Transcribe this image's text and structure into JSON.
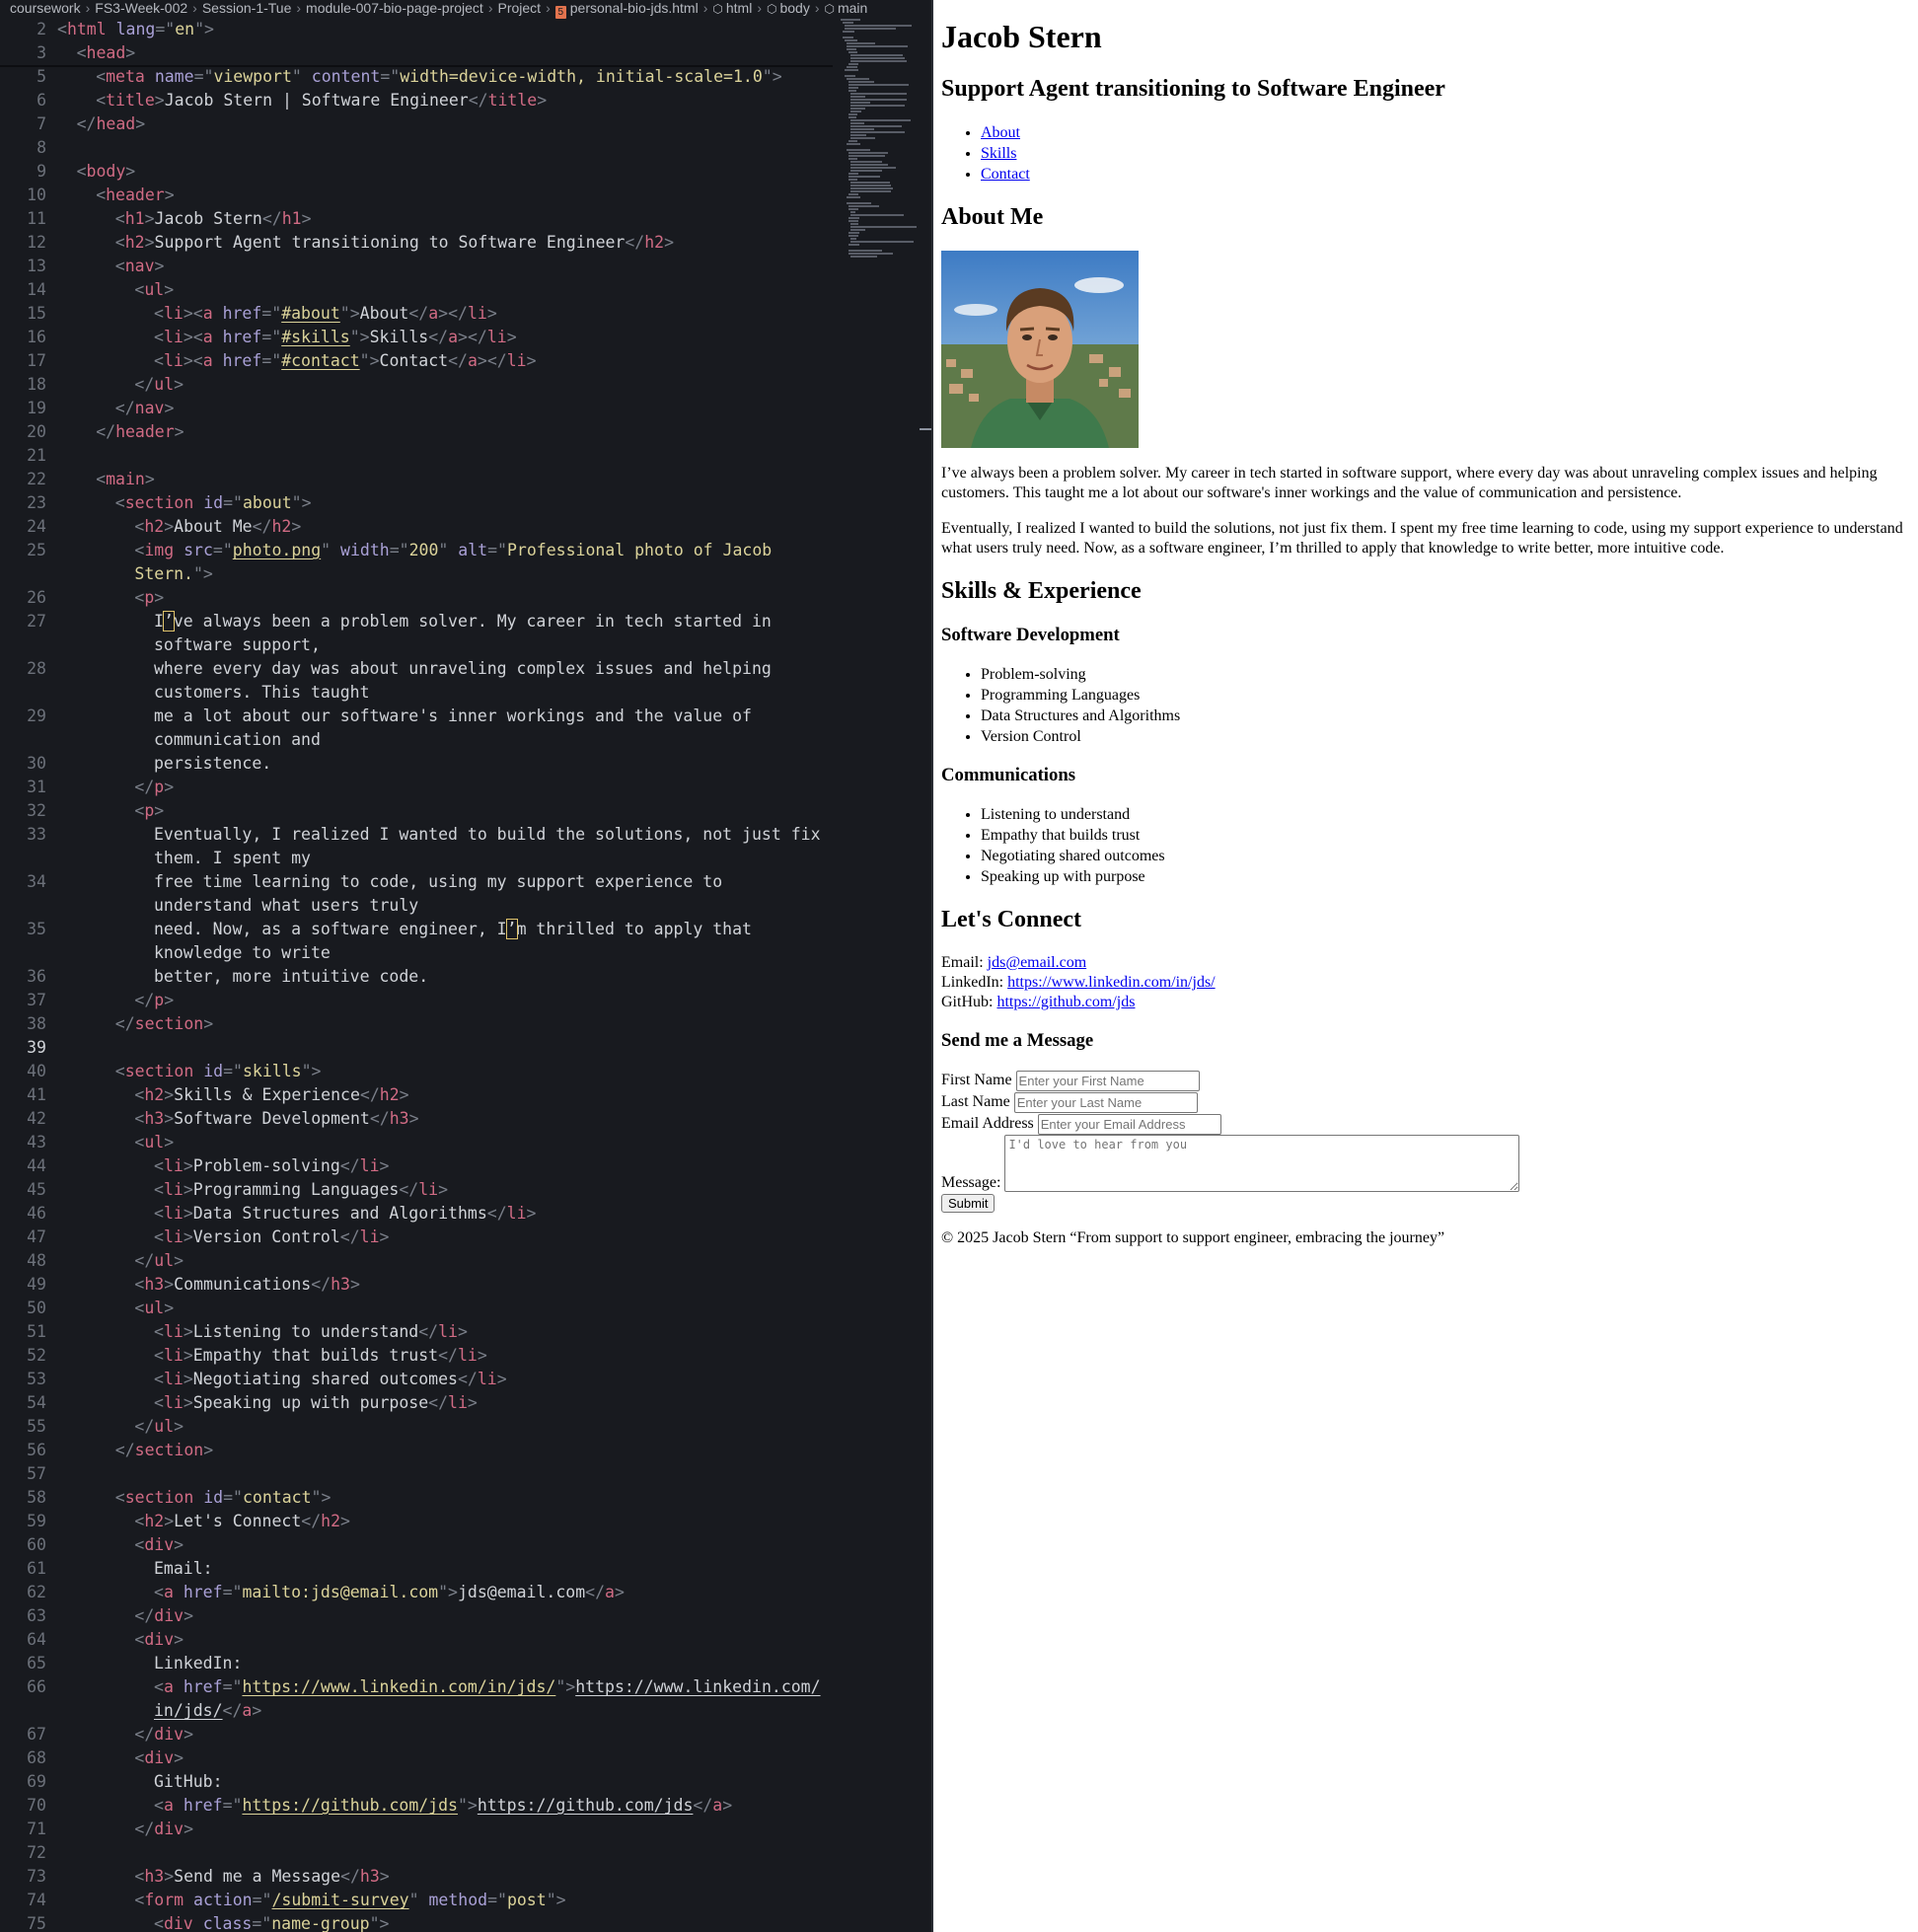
{
  "breadcrumb": [
    "coursework",
    "FS3-Week-002",
    "Session-1-Tue",
    "module-007-bio-page-project",
    "Project",
    "personal-bio-jds.html",
    "html",
    "body",
    "main"
  ],
  "editor": {
    "lines": [
      {
        "n": "2",
        "i": 0,
        "h": "<span class=\"pu\">&lt;</span><span class=\"tg\">html</span> <span class=\"at\">lang</span><span class=\"pu\">=\"</span><span class=\"st\">en</span><span class=\"pu\">\"&gt;</span>"
      },
      {
        "n": "3",
        "i": 1,
        "h": "<span class=\"pu\">&lt;</span><span class=\"tg\">head</span><span class=\"pu\">&gt;</span>"
      },
      {
        "n": "5",
        "i": 2,
        "h": "<span class=\"pu\">&lt;</span><span class=\"tg\">meta</span> <span class=\"at\">name</span><span class=\"pu\">=\"</span><span class=\"st\">viewport</span><span class=\"pu\">\"</span> <span class=\"at\">content</span><span class=\"pu\">=\"</span><span class=\"st\">width=device-width, initial-scale=1.0</span><span class=\"pu\">\"&gt;</span>"
      },
      {
        "n": "6",
        "i": 2,
        "h": "<span class=\"pu\">&lt;</span><span class=\"tg\">title</span><span class=\"pu\">&gt;</span>Jacob Stern | Software Engineer<span class=\"pu\">&lt;/</span><span class=\"tg\">title</span><span class=\"pu\">&gt;</span>"
      },
      {
        "n": "7",
        "i": 1,
        "h": "<span class=\"pu\">&lt;/</span><span class=\"tg\">head</span><span class=\"pu\">&gt;</span>"
      },
      {
        "n": "8",
        "i": 0,
        "h": ""
      },
      {
        "n": "9",
        "i": 1,
        "h": "<span class=\"pu\">&lt;</span><span class=\"tg\">body</span><span class=\"pu\">&gt;</span>"
      },
      {
        "n": "10",
        "i": 2,
        "h": "<span class=\"pu\">&lt;</span><span class=\"tg\">header</span><span class=\"pu\">&gt;</span>"
      },
      {
        "n": "11",
        "i": 3,
        "h": "<span class=\"pu\">&lt;</span><span class=\"tg\">h1</span><span class=\"pu\">&gt;</span>Jacob Stern<span class=\"pu\">&lt;/</span><span class=\"tg\">h1</span><span class=\"pu\">&gt;</span>"
      },
      {
        "n": "12",
        "i": 3,
        "h": "<span class=\"pu\">&lt;</span><span class=\"tg\">h2</span><span class=\"pu\">&gt;</span>Support Agent transitioning to Software Engineer<span class=\"pu\">&lt;/</span><span class=\"tg\">h2</span><span class=\"pu\">&gt;</span>"
      },
      {
        "n": "13",
        "i": 3,
        "h": "<span class=\"pu\">&lt;</span><span class=\"tg\">nav</span><span class=\"pu\">&gt;</span>"
      },
      {
        "n": "14",
        "i": 4,
        "h": "<span class=\"pu\">&lt;</span><span class=\"tg\">ul</span><span class=\"pu\">&gt;</span>"
      },
      {
        "n": "15",
        "i": 5,
        "h": "<span class=\"pu\">&lt;</span><span class=\"tg\">li</span><span class=\"pu\">&gt;&lt;</span><span class=\"tg\">a</span> <span class=\"at\">href</span><span class=\"pu\">=\"</span><span class=\"st ul\">#about</span><span class=\"pu\">\"&gt;</span>About<span class=\"pu\">&lt;/</span><span class=\"tg\">a</span><span class=\"pu\">&gt;&lt;/</span><span class=\"tg\">li</span><span class=\"pu\">&gt;</span>"
      },
      {
        "n": "16",
        "i": 5,
        "h": "<span class=\"pu\">&lt;</span><span class=\"tg\">li</span><span class=\"pu\">&gt;&lt;</span><span class=\"tg\">a</span> <span class=\"at\">href</span><span class=\"pu\">=\"</span><span class=\"st ul\">#skills</span><span class=\"pu\">\"&gt;</span>Skills<span class=\"pu\">&lt;/</span><span class=\"tg\">a</span><span class=\"pu\">&gt;&lt;/</span><span class=\"tg\">li</span><span class=\"pu\">&gt;</span>"
      },
      {
        "n": "17",
        "i": 5,
        "h": "<span class=\"pu\">&lt;</span><span class=\"tg\">li</span><span class=\"pu\">&gt;&lt;</span><span class=\"tg\">a</span> <span class=\"at\">href</span><span class=\"pu\">=\"</span><span class=\"st ul\">#contact</span><span class=\"pu\">\"&gt;</span>Contact<span class=\"pu\">&lt;/</span><span class=\"tg\">a</span><span class=\"pu\">&gt;&lt;/</span><span class=\"tg\">li</span><span class=\"pu\">&gt;</span>"
      },
      {
        "n": "18",
        "i": 4,
        "h": "<span class=\"pu\">&lt;/</span><span class=\"tg\">ul</span><span class=\"pu\">&gt;</span>"
      },
      {
        "n": "19",
        "i": 3,
        "h": "<span class=\"pu\">&lt;/</span><span class=\"tg\">nav</span><span class=\"pu\">&gt;</span>"
      },
      {
        "n": "20",
        "i": 2,
        "h": "<span class=\"pu\">&lt;/</span><span class=\"tg\">header</span><span class=\"pu\">&gt;</span>"
      },
      {
        "n": "21",
        "i": 0,
        "h": ""
      },
      {
        "n": "22",
        "i": 2,
        "h": "<span class=\"pu\">&lt;</span><span class=\"tg\">main</span><span class=\"pu\">&gt;</span>"
      },
      {
        "n": "23",
        "i": 3,
        "h": "<span class=\"pu\">&lt;</span><span class=\"tg\">section</span> <span class=\"at\">id</span><span class=\"pu\">=\"</span><span class=\"st\">about</span><span class=\"pu\">\"&gt;</span>"
      },
      {
        "n": "24",
        "i": 4,
        "h": "<span class=\"pu\">&lt;</span><span class=\"tg\">h2</span><span class=\"pu\">&gt;</span>About Me<span class=\"pu\">&lt;/</span><span class=\"tg\">h2</span><span class=\"pu\">&gt;</span>"
      },
      {
        "n": "25",
        "i": 4,
        "h": "<span class=\"pu\">&lt;</span><span class=\"tg\">img</span> <span class=\"at\">src</span><span class=\"pu\">=\"</span><span class=\"st ul\">photo.png</span><span class=\"pu\">\"</span> <span class=\"at\">width</span><span class=\"pu\">=\"</span><span class=\"st\">200</span><span class=\"pu\">\"</span> <span class=\"at\">alt</span><span class=\"pu\">=\"</span><span class=\"st\">Professional photo of Jacob</span>"
      },
      {
        "n": "",
        "i": 4,
        "h": "<span class=\"st\">Stern.</span><span class=\"pu\">\"&gt;</span>"
      },
      {
        "n": "26",
        "i": 4,
        "h": "<span class=\"pu\">&lt;</span><span class=\"tg\">p</span><span class=\"pu\">&gt;</span>"
      },
      {
        "n": "27",
        "i": 5,
        "h": "I<span class=\"hl\">’</span>ve always been a problem solver. My career in tech started in"
      },
      {
        "n": "",
        "i": 5,
        "h": "software support,"
      },
      {
        "n": "28",
        "i": 5,
        "h": "where every day was about unraveling complex issues and helping"
      },
      {
        "n": "",
        "i": 5,
        "h": "customers. This taught"
      },
      {
        "n": "29",
        "i": 5,
        "h": "me a lot about our software's inner workings and the value of"
      },
      {
        "n": "",
        "i": 5,
        "h": "communication and"
      },
      {
        "n": "30",
        "i": 5,
        "h": "persistence."
      },
      {
        "n": "31",
        "i": 4,
        "h": "<span class=\"pu\">&lt;/</span><span class=\"tg\">p</span><span class=\"pu\">&gt;</span>"
      },
      {
        "n": "32",
        "i": 4,
        "h": "<span class=\"pu\">&lt;</span><span class=\"tg\">p</span><span class=\"pu\">&gt;</span>"
      },
      {
        "n": "33",
        "i": 5,
        "h": "Eventually, I realized I wanted to build the solutions, not just fix"
      },
      {
        "n": "",
        "i": 5,
        "h": "them. I spent my"
      },
      {
        "n": "34",
        "i": 5,
        "h": "free time learning to code, using my support experience to"
      },
      {
        "n": "",
        "i": 5,
        "h": "understand what users truly"
      },
      {
        "n": "35",
        "i": 5,
        "h": "need. Now, as a software engineer, I<span class=\"hl\">’</span>m thrilled to apply that"
      },
      {
        "n": "",
        "i": 5,
        "h": "knowledge to write"
      },
      {
        "n": "36",
        "i": 5,
        "h": "better, more intuitive code."
      },
      {
        "n": "37",
        "i": 4,
        "h": "<span class=\"pu\">&lt;/</span><span class=\"tg\">p</span><span class=\"pu\">&gt;</span>"
      },
      {
        "n": "38",
        "i": 3,
        "h": "<span class=\"pu\">&lt;/</span><span class=\"tg\">section</span><span class=\"pu\">&gt;</span>"
      },
      {
        "n": "39",
        "i": 0,
        "h": "",
        "active": true
      },
      {
        "n": "40",
        "i": 3,
        "h": "<span class=\"pu\">&lt;</span><span class=\"tg\">section</span> <span class=\"at\">id</span><span class=\"pu\">=\"</span><span class=\"st\">skills</span><span class=\"pu\">\"&gt;</span>"
      },
      {
        "n": "41",
        "i": 4,
        "h": "<span class=\"pu\">&lt;</span><span class=\"tg\">h2</span><span class=\"pu\">&gt;</span>Skills &amp; Experience<span class=\"pu\">&lt;/</span><span class=\"tg\">h2</span><span class=\"pu\">&gt;</span>"
      },
      {
        "n": "42",
        "i": 4,
        "h": "<span class=\"pu\">&lt;</span><span class=\"tg\">h3</span><span class=\"pu\">&gt;</span>Software Development<span class=\"pu\">&lt;/</span><span class=\"tg\">h3</span><span class=\"pu\">&gt;</span>"
      },
      {
        "n": "43",
        "i": 4,
        "h": "<span class=\"pu\">&lt;</span><span class=\"tg\">ul</span><span class=\"pu\">&gt;</span>"
      },
      {
        "n": "44",
        "i": 5,
        "h": "<span class=\"pu\">&lt;</span><span class=\"tg\">li</span><span class=\"pu\">&gt;</span>Problem-solving<span class=\"pu\">&lt;/</span><span class=\"tg\">li</span><span class=\"pu\">&gt;</span>"
      },
      {
        "n": "45",
        "i": 5,
        "h": "<span class=\"pu\">&lt;</span><span class=\"tg\">li</span><span class=\"pu\">&gt;</span>Programming Languages<span class=\"pu\">&lt;/</span><span class=\"tg\">li</span><span class=\"pu\">&gt;</span>"
      },
      {
        "n": "46",
        "i": 5,
        "h": "<span class=\"pu\">&lt;</span><span class=\"tg\">li</span><span class=\"pu\">&gt;</span>Data Structures and Algorithms<span class=\"pu\">&lt;/</span><span class=\"tg\">li</span><span class=\"pu\">&gt;</span>"
      },
      {
        "n": "47",
        "i": 5,
        "h": "<span class=\"pu\">&lt;</span><span class=\"tg\">li</span><span class=\"pu\">&gt;</span>Version Control<span class=\"pu\">&lt;/</span><span class=\"tg\">li</span><span class=\"pu\">&gt;</span>"
      },
      {
        "n": "48",
        "i": 4,
        "h": "<span class=\"pu\">&lt;/</span><span class=\"tg\">ul</span><span class=\"pu\">&gt;</span>"
      },
      {
        "n": "49",
        "i": 4,
        "h": "<span class=\"pu\">&lt;</span><span class=\"tg\">h3</span><span class=\"pu\">&gt;</span>Communications<span class=\"pu\">&lt;/</span><span class=\"tg\">h3</span><span class=\"pu\">&gt;</span>"
      },
      {
        "n": "50",
        "i": 4,
        "h": "<span class=\"pu\">&lt;</span><span class=\"tg\">ul</span><span class=\"pu\">&gt;</span>"
      },
      {
        "n": "51",
        "i": 5,
        "h": "<span class=\"pu\">&lt;</span><span class=\"tg\">li</span><span class=\"pu\">&gt;</span>Listening to understand<span class=\"pu\">&lt;/</span><span class=\"tg\">li</span><span class=\"pu\">&gt;</span>"
      },
      {
        "n": "52",
        "i": 5,
        "h": "<span class=\"pu\">&lt;</span><span class=\"tg\">li</span><span class=\"pu\">&gt;</span>Empathy that builds trust<span class=\"pu\">&lt;/</span><span class=\"tg\">li</span><span class=\"pu\">&gt;</span>"
      },
      {
        "n": "53",
        "i": 5,
        "h": "<span class=\"pu\">&lt;</span><span class=\"tg\">li</span><span class=\"pu\">&gt;</span>Negotiating shared outcomes<span class=\"pu\">&lt;/</span><span class=\"tg\">li</span><span class=\"pu\">&gt;</span>"
      },
      {
        "n": "54",
        "i": 5,
        "h": "<span class=\"pu\">&lt;</span><span class=\"tg\">li</span><span class=\"pu\">&gt;</span>Speaking up with purpose<span class=\"pu\">&lt;/</span><span class=\"tg\">li</span><span class=\"pu\">&gt;</span>"
      },
      {
        "n": "55",
        "i": 4,
        "h": "<span class=\"pu\">&lt;/</span><span class=\"tg\">ul</span><span class=\"pu\">&gt;</span>"
      },
      {
        "n": "56",
        "i": 3,
        "h": "<span class=\"pu\">&lt;/</span><span class=\"tg\">section</span><span class=\"pu\">&gt;</span>"
      },
      {
        "n": "57",
        "i": 0,
        "h": ""
      },
      {
        "n": "58",
        "i": 3,
        "h": "<span class=\"pu\">&lt;</span><span class=\"tg\">section</span> <span class=\"at\">id</span><span class=\"pu\">=\"</span><span class=\"st\">contact</span><span class=\"pu\">\"&gt;</span>"
      },
      {
        "n": "59",
        "i": 4,
        "h": "<span class=\"pu\">&lt;</span><span class=\"tg\">h2</span><span class=\"pu\">&gt;</span>Let's Connect<span class=\"pu\">&lt;/</span><span class=\"tg\">h2</span><span class=\"pu\">&gt;</span>"
      },
      {
        "n": "60",
        "i": 4,
        "h": "<span class=\"pu\">&lt;</span><span class=\"tg\">div</span><span class=\"pu\">&gt;</span>"
      },
      {
        "n": "61",
        "i": 5,
        "h": "Email:"
      },
      {
        "n": "62",
        "i": 5,
        "h": "<span class=\"pu\">&lt;</span><span class=\"tg\">a</span> <span class=\"at\">href</span><span class=\"pu\">=\"</span><span class=\"st\">mailto:jds@email.com</span><span class=\"pu\">\"&gt;</span>jds@email.com<span class=\"pu\">&lt;/</span><span class=\"tg\">a</span><span class=\"pu\">&gt;</span>"
      },
      {
        "n": "63",
        "i": 4,
        "h": "<span class=\"pu\">&lt;/</span><span class=\"tg\">div</span><span class=\"pu\">&gt;</span>"
      },
      {
        "n": "64",
        "i": 4,
        "h": "<span class=\"pu\">&lt;</span><span class=\"tg\">div</span><span class=\"pu\">&gt;</span>"
      },
      {
        "n": "65",
        "i": 5,
        "h": "LinkedIn:"
      },
      {
        "n": "66",
        "i": 5,
        "h": "<span class=\"pu\">&lt;</span><span class=\"tg\">a</span> <span class=\"at\">href</span><span class=\"pu\">=\"</span><span class=\"st ul\">https://www.linkedin.com/in/jds/</span><span class=\"pu\">\"&gt;</span><span class=\"ul\">https://www.linkedin.com/</span>"
      },
      {
        "n": "",
        "i": 5,
        "h": "<span class=\"ul\">in/jds/</span><span class=\"pu\">&lt;/</span><span class=\"tg\">a</span><span class=\"pu\">&gt;</span>"
      },
      {
        "n": "67",
        "i": 4,
        "h": "<span class=\"pu\">&lt;/</span><span class=\"tg\">div</span><span class=\"pu\">&gt;</span>"
      },
      {
        "n": "68",
        "i": 4,
        "h": "<span class=\"pu\">&lt;</span><span class=\"tg\">div</span><span class=\"pu\">&gt;</span>"
      },
      {
        "n": "69",
        "i": 5,
        "h": "GitHub:"
      },
      {
        "n": "70",
        "i": 5,
        "h": "<span class=\"pu\">&lt;</span><span class=\"tg\">a</span> <span class=\"at\">href</span><span class=\"pu\">=\"</span><span class=\"st ul\">https://github.com/jds</span><span class=\"pu\">\"&gt;</span><span class=\"ul\">https://github.com/jds</span><span class=\"pu\">&lt;/</span><span class=\"tg\">a</span><span class=\"pu\">&gt;</span>"
      },
      {
        "n": "71",
        "i": 4,
        "h": "<span class=\"pu\">&lt;/</span><span class=\"tg\">div</span><span class=\"pu\">&gt;</span>"
      },
      {
        "n": "72",
        "i": 0,
        "h": ""
      },
      {
        "n": "73",
        "i": 4,
        "h": "<span class=\"pu\">&lt;</span><span class=\"tg\">h3</span><span class=\"pu\">&gt;</span>Send me a Message<span class=\"pu\">&lt;/</span><span class=\"tg\">h3</span><span class=\"pu\">&gt;</span>"
      },
      {
        "n": "74",
        "i": 4,
        "h": "<span class=\"pu\">&lt;</span><span class=\"tg\">form</span> <span class=\"at\">action</span><span class=\"pu\">=\"</span><span class=\"st ul\">/submit-survey</span><span class=\"pu\">\"</span> <span class=\"at\">method</span><span class=\"pu\">=\"</span><span class=\"st\">post</span><span class=\"pu\">\"&gt;</span>"
      },
      {
        "n": "75",
        "i": 5,
        "h": "<span class=\"pu\">&lt;</span><span class=\"tg\">div</span> <span class=\"at\">class</span><span class=\"pu\">=\"</span><span class=\"st\">name-group</span><span class=\"pu\">\"&gt;</span>"
      }
    ]
  },
  "preview": {
    "h1": "Jacob Stern",
    "subtitle": "Support Agent transitioning to Software Engineer",
    "nav": [
      "About",
      "Skills",
      "Contact"
    ],
    "about": {
      "heading": "About Me",
      "photo_alt": "Professional photo of Jacob Stern.",
      "p1": "I’ve always been a problem solver. My career in tech started in software support, where every day was about unraveling complex issues and helping customers. This taught me a lot about our software's inner workings and the value of communication and persistence.",
      "p2": "Eventually, I realized I wanted to build the solutions, not just fix them. I spent my free time learning to code, using my support experience to understand what users truly need. Now, as a software engineer, I’m thrilled to apply that knowledge to write better, more intuitive code."
    },
    "skills": {
      "heading": "Skills & Experience",
      "dev_heading": "Software Development",
      "dev": [
        "Problem-solving",
        "Programming Languages",
        "Data Structures and Algorithms",
        "Version Control"
      ],
      "comm_heading": "Communications",
      "comm": [
        "Listening to understand",
        "Empathy that builds trust",
        "Negotiating shared outcomes",
        "Speaking up with purpose"
      ]
    },
    "contact": {
      "heading": "Let's Connect",
      "email_label": "Email:",
      "email": "jds@email.com",
      "linkedin_label": "LinkedIn:",
      "linkedin": "https://www.linkedin.com/in/jds/",
      "github_label": "GitHub:",
      "github": "https://github.com/jds"
    },
    "form": {
      "heading": "Send me a Message",
      "first_label": "First Name",
      "first_placeholder": "Enter your First Name",
      "last_label": "Last Name",
      "last_placeholder": "Enter your Last Name",
      "email_label": "Email Address",
      "email_placeholder": "Enter your Email Address",
      "message_label": "Message:",
      "message_placeholder": "I'd love to hear from you",
      "submit": "Submit"
    },
    "footer": "© 2025 Jacob Stern “From support to support engineer, embracing the journey”"
  }
}
